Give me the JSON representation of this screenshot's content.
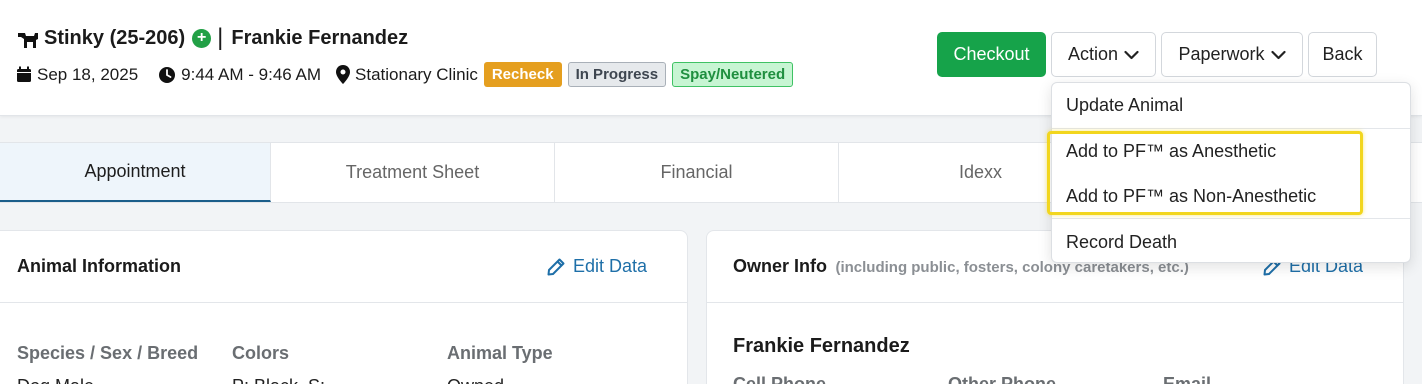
{
  "header": {
    "animal_name": "Stinky (25-206)",
    "owner_name": "Frankie Fernandez",
    "separator": "|",
    "plus_symbol": "+",
    "date": "Sep 18, 2025",
    "time": "9:44 AM - 9:46 AM",
    "location": "Stationary Clinic",
    "badges": {
      "recheck": "Recheck",
      "in_progress": "In Progress",
      "spay": "Spay/Neutered"
    }
  },
  "toolbar": {
    "checkout": "Checkout",
    "action": "Action",
    "paperwork": "Paperwork",
    "back": "Back"
  },
  "action_menu": {
    "items": [
      "Update Animal",
      "Add to PF™ as Anesthetic",
      "Add to PF™ as Non-Anesthetic",
      "Record Death"
    ]
  },
  "tabs": [
    "Appointment",
    "Treatment Sheet",
    "Financial",
    "Idexx"
  ],
  "animal_card": {
    "title": "Animal Information",
    "edit": "Edit Data",
    "fields": [
      {
        "label": "Species / Sex / Breed",
        "value": "Dog Male -"
      },
      {
        "label": "Colors",
        "value": "P: Black, S: ---"
      },
      {
        "label": "Animal Type",
        "value": "Owned"
      }
    ]
  },
  "owner_card": {
    "title": "Owner Info",
    "subtitle": "(including public, fosters, colony caretakers, etc.)",
    "edit": "Edit Data",
    "name": "Frankie Fernandez",
    "fields": [
      "Cell Phone",
      "Other Phone",
      "Email"
    ]
  },
  "colors": {
    "checkout": "#16a34a",
    "link": "#1e6fa8",
    "recheck": "#e59f1f",
    "highlight": "#f2d61e"
  },
  "icons": [
    "dog-icon",
    "plus-circle-icon",
    "calendar-icon",
    "clock-icon",
    "map-pin-icon",
    "chevron-down-icon",
    "pencil-icon"
  ]
}
